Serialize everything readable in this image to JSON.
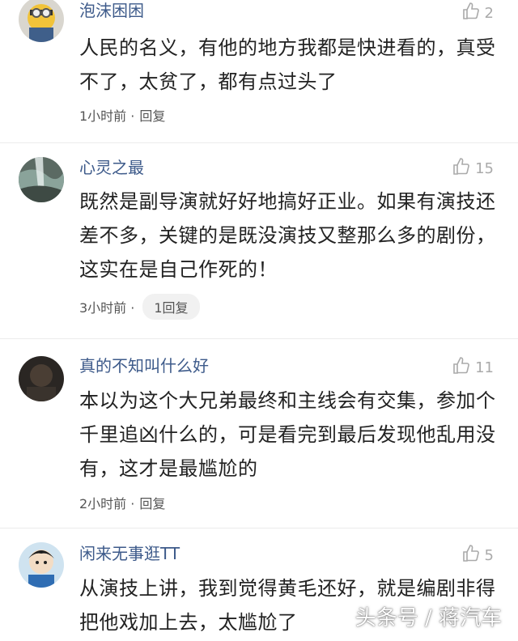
{
  "comments": [
    {
      "username": "泡沫困困",
      "likes": "2",
      "text": "人民的名义，有他的地方我都是快进看的，真受不了，太贫了，都有点过头了",
      "time": "1小时前 ·",
      "reply": "回复"
    },
    {
      "username": "心灵之最",
      "likes": "15",
      "text": "既然是副导演就好好地搞好正业。如果有演技还差不多，关键的是既没演技又整那么多的剧份，这实在是自己作死的！",
      "time": "3小时前 ·",
      "reply": "1回复"
    },
    {
      "username": "真的不知叫什么好",
      "likes": "11",
      "text": "本以为这个大兄弟最终和主线会有交集，参加个千里追凶什么的，可是看完到最后发现他乱用没有，这才是最尴尬的",
      "time": "2小时前 ·",
      "reply": "回复"
    },
    {
      "username": "闲来无事逛TT",
      "likes": "5",
      "text": "从演技上讲，我到觉得黄毛还好，就是编剧非得把他戏加上去，太尴尬了"
    }
  ],
  "watermark": "头条号 / 蒋汽车",
  "colors": {
    "username": "#3d5a8a",
    "meta_text": "#555555",
    "like_icon": "#aaaaaa"
  }
}
